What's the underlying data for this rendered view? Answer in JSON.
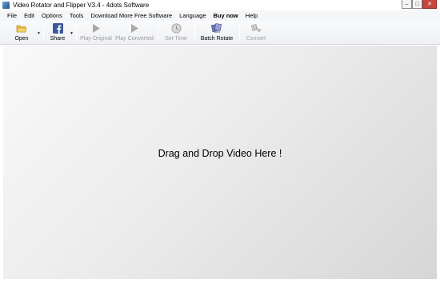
{
  "window": {
    "title": "Video Rotator and Flipper V3.4 - 4dots Software",
    "controls": {
      "minimize": "–",
      "maximize": "□",
      "close": "✕"
    }
  },
  "menu": {
    "items": [
      {
        "label": "File",
        "bold": false
      },
      {
        "label": "Edit",
        "bold": false
      },
      {
        "label": "Options",
        "bold": false
      },
      {
        "label": "Tools",
        "bold": false
      },
      {
        "label": "Download More Free Software",
        "bold": false
      },
      {
        "label": "Language",
        "bold": false
      },
      {
        "label": "Buy now",
        "bold": true
      },
      {
        "label": "Help",
        "bold": false
      }
    ]
  },
  "toolbar": {
    "open": {
      "label": "Open",
      "icon": "folder-icon",
      "enabled": true
    },
    "share": {
      "label": "Share",
      "icon": "facebook-icon",
      "enabled": true
    },
    "play_original": {
      "label": "Play Original",
      "icon": "play-icon",
      "enabled": false
    },
    "play_converted": {
      "label": "Play Converted",
      "icon": "play-icon",
      "enabled": false
    },
    "set_time": {
      "label": "Set Time",
      "icon": "clock-icon",
      "enabled": false
    },
    "batch_rotate": {
      "label": "Batch Rotate",
      "icon": "batch-icon",
      "enabled": true
    },
    "convert": {
      "label": "Convert",
      "icon": "convert-icon",
      "enabled": false
    },
    "dropdown_glyph": "▼"
  },
  "drop_area": {
    "text": "Drag and Drop Video Here !"
  },
  "colors": {
    "facebook": "#3b5998",
    "folder": "#e8b83a",
    "disabled_icon": "#a9a9a9",
    "close_button": "#c9463d"
  }
}
